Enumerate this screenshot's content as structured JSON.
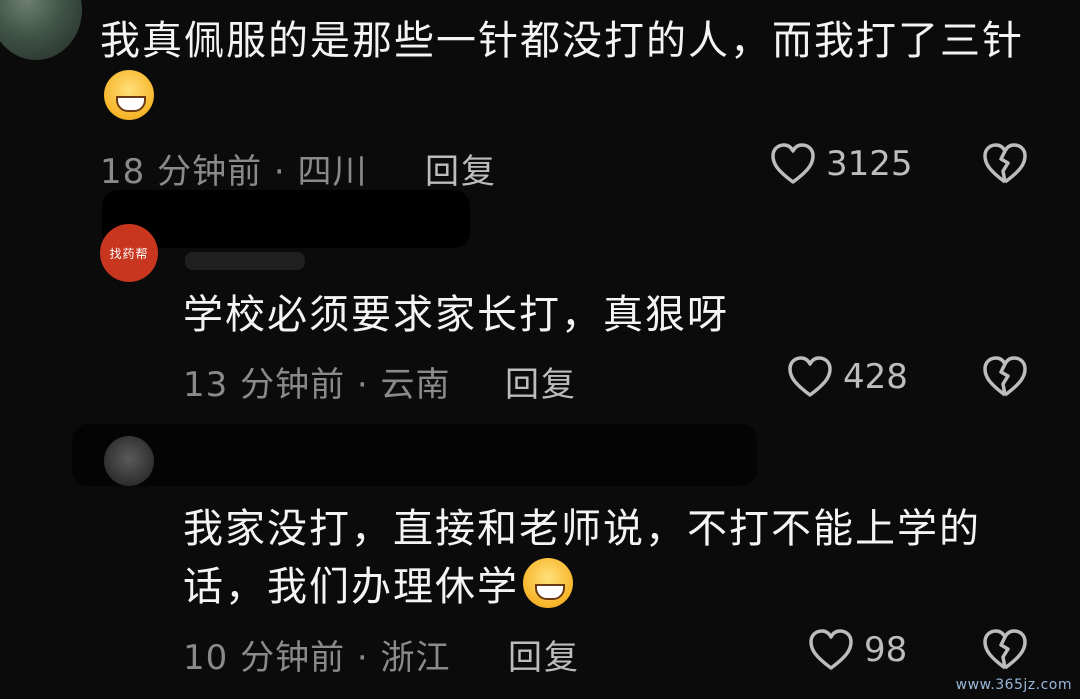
{
  "comments": [
    {
      "text": "我真佩服的是那些一针都没打的人，而我打了三针",
      "meta": "18 分钟前 · 四川",
      "reply": "回复",
      "likes": "3125"
    },
    {
      "avatar_label": "找药帮",
      "text": "学校必须要求家长打，真狠呀",
      "meta": "13 分钟前 · 云南",
      "reply": "回复",
      "likes": "428"
    },
    {
      "text": "我家没打，直接和老师说，不打不能上学的话，我们办理休学",
      "meta": "10 分钟前 · 浙江",
      "reply": "回复",
      "likes": "98"
    }
  ],
  "watermark": "www.365jz.com",
  "icons": {
    "like": "heart-outline-icon",
    "dislike": "broken-heart-icon",
    "emoji_1": "laughing-tears-emoji",
    "emoji_2": "grin-sweat-emoji"
  }
}
